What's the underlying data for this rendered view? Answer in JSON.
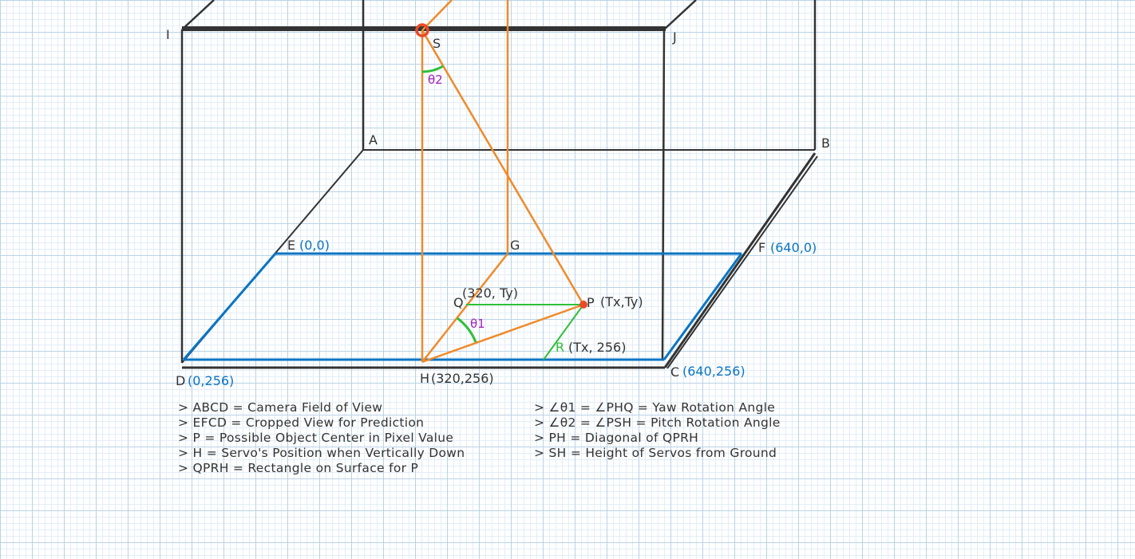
{
  "points": {
    "I": "I",
    "J": "J",
    "S": "S",
    "A": "A",
    "B": "B",
    "E": "E",
    "F": "F",
    "G": "G",
    "Q": "Q",
    "P": "P",
    "R": "R",
    "H": "H",
    "C": "C",
    "D": "D"
  },
  "coords": {
    "E": "(0,0)",
    "F": "(640,0)",
    "C": "(640,256)",
    "D": "(0,256)",
    "H": "(320,256)",
    "Q": "(320, Ty)",
    "P": "(Tx,Ty)",
    "R": "(Tx, 256)"
  },
  "angles": {
    "theta1": "θ1",
    "theta2": "θ2"
  },
  "legend_left": [
    "> ABCD = Camera Field of View",
    "> EFCD = Cropped View for Prediction",
    "> P = Possible Object Center in Pixel Value",
    "> H = Servo's Position when Vertically Down",
    "> QPRH = Rectangle on Surface for P"
  ],
  "legend_right": [
    "> ∠θ1 = ∠PHQ = Yaw Rotation Angle",
    "> ∠θ2 = ∠PSH = Pitch Rotation Angle",
    "> PH = Diagonal of QPRH",
    "> SH = Height of Servos from Ground"
  ],
  "colors": {
    "frame": "#333333",
    "crop": "#0a74c4",
    "servo_lines": "#f08a2a",
    "rectangle": "#2fbf3a",
    "angle_text": "#a020c0",
    "point_marker": "#e84a2a"
  }
}
